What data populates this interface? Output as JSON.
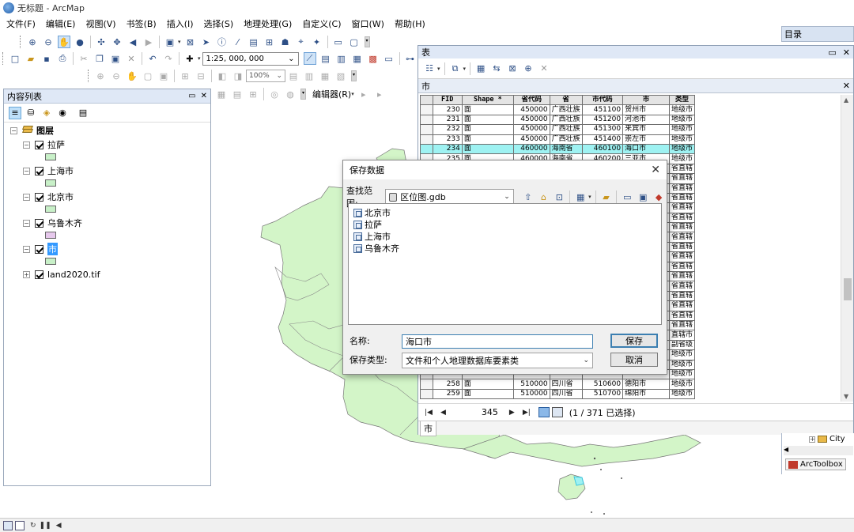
{
  "window": {
    "title": "无标题 - ArcMap"
  },
  "menu": [
    "文件(F)",
    "编辑(E)",
    "视图(V)",
    "书签(B)",
    "插入(I)",
    "选择(S)",
    "地理处理(G)",
    "自定义(C)",
    "窗口(W)",
    "帮助(H)"
  ],
  "toolbar": {
    "scale_value": "1:25, 000, 000",
    "zoom_value": "100%",
    "editor_label": "编辑器(R)"
  },
  "toc": {
    "title": "内容列表",
    "root_label": "图层",
    "layers": [
      {
        "label": "拉萨",
        "swatch": "#c8f0c8"
      },
      {
        "label": "上海市",
        "swatch": "#c8f0c8"
      },
      {
        "label": "北京市",
        "swatch": "#c8f0c8"
      },
      {
        "label": "乌鲁木齐",
        "swatch": "#e6c8ec"
      },
      {
        "label": "市",
        "swatch": "#c8f0c8"
      },
      {
        "label": "land2020.tif",
        "swatch": ""
      }
    ]
  },
  "table_window": {
    "title": "表",
    "tab_title": "市",
    "columns": [
      "FID",
      "Shape *",
      "省代码",
      "省",
      "市代码",
      "市",
      "类型"
    ],
    "rows": [
      [
        "230",
        "面",
        "450000",
        "广西壮族",
        "451100",
        "贺州市",
        "地级市"
      ],
      [
        "231",
        "面",
        "450000",
        "广西壮族",
        "451200",
        "河池市",
        "地级市"
      ],
      [
        "232",
        "面",
        "450000",
        "广西壮族",
        "451300",
        "来宾市",
        "地级市"
      ],
      [
        "233",
        "面",
        "450000",
        "广西壮族",
        "451400",
        "崇左市",
        "地级市"
      ],
      [
        "234",
        "面",
        "460000",
        "海南省",
        "460100",
        "海口市",
        "地级市"
      ],
      [
        "235",
        "面",
        "460000",
        "海南省",
        "460200",
        "三亚市",
        "地级市"
      ]
    ],
    "side_types": [
      "地级市",
      "地级市",
      "省直辖",
      "省直辖",
      "省直辖",
      "省直辖",
      "省直辖",
      "省直辖",
      "省直辖",
      "省直辖",
      "省直辖",
      "省直辖",
      "省直辖",
      "省直辖",
      "省直辖",
      "省直辖",
      "省直辖",
      "省直辖",
      "省直辖",
      "直辖市",
      "副省级",
      "地级市",
      "地级市",
      "地级市"
    ],
    "bottom_rows": [
      [
        "258",
        "面",
        "510000",
        "四川省",
        "510600",
        "德阳市",
        "地级市"
      ],
      [
        "259",
        "面",
        "510000",
        "四川省",
        "510700",
        "绵阳市",
        "地级市"
      ]
    ],
    "nav": {
      "record": "345",
      "selection": "(1 / 371 已选择)"
    },
    "bottom_tab": "市"
  },
  "catalog": {
    "title": "目录",
    "tree_item": "City",
    "toolbox_tab": "ArcToolbox"
  },
  "dialog": {
    "title": "保存数据",
    "lookin_label": "查找范围:",
    "lookin_value": "区位图.gdb",
    "items": [
      "北京市",
      "拉萨",
      "上海市",
      "乌鲁木齐"
    ],
    "name_label": "名称:",
    "name_value": "海口市",
    "type_label": "保存类型:",
    "type_value": "文件和个人地理数据库要素类",
    "save_button": "保存",
    "cancel_button": "取消"
  },
  "colors": {
    "accent": "#3399ff",
    "map_fill": "#d3f5c8",
    "highlight": "#9ef2f2"
  }
}
